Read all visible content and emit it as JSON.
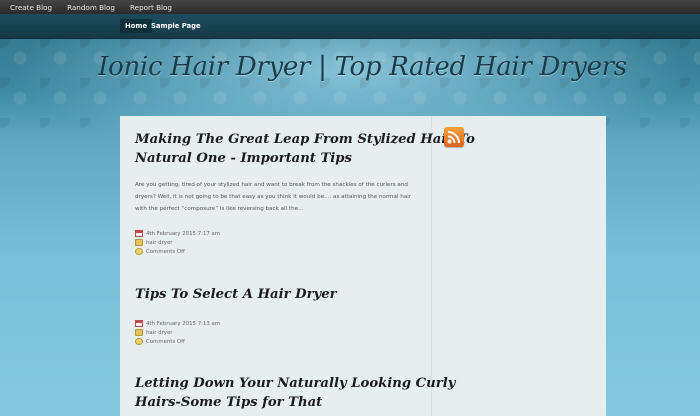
{
  "adminbar": {
    "items": [
      "Create Blog",
      "Random Blog",
      "Report Blog"
    ]
  },
  "nav": {
    "items": [
      "Home",
      "Sample Page"
    ],
    "active": "Home"
  },
  "site": {
    "title": "Ionic Hair Dryer | Top Rated Hair Dryers"
  },
  "posts": [
    {
      "title_line1": "Making The Great Leap From Stylized Hair To",
      "title_line2": "Natural One - Important Tips",
      "excerpt": "Are you getting, tired of your stylized hair and want to break from the shackles of the curlers and dryers? Well, it is not going to be that easy as you think it would be.... as attaining the normal hair with the perfect “composure” is like reversing back all the...",
      "date": "4th February 2015 7:17 am",
      "category": "hair dryer",
      "comments": "Comments Off"
    },
    {
      "title_line1": "Tips To Select A Hair Dryer",
      "date": "4th February 2015 7:13 am",
      "category": "hair dryer",
      "comments": "Comments Off"
    },
    {
      "title_line1": "Letting Down Your Naturally Looking Curly",
      "title_line2": "Hairs-Some Tips for That"
    }
  ],
  "sidebar": {
    "feed_icon": "rss-feed-icon"
  },
  "colors": {
    "accent_rss": "#f47b20",
    "nav_bg": "#143947",
    "content_bg": "#e7eef0",
    "title_color": "#1a3c4a"
  }
}
